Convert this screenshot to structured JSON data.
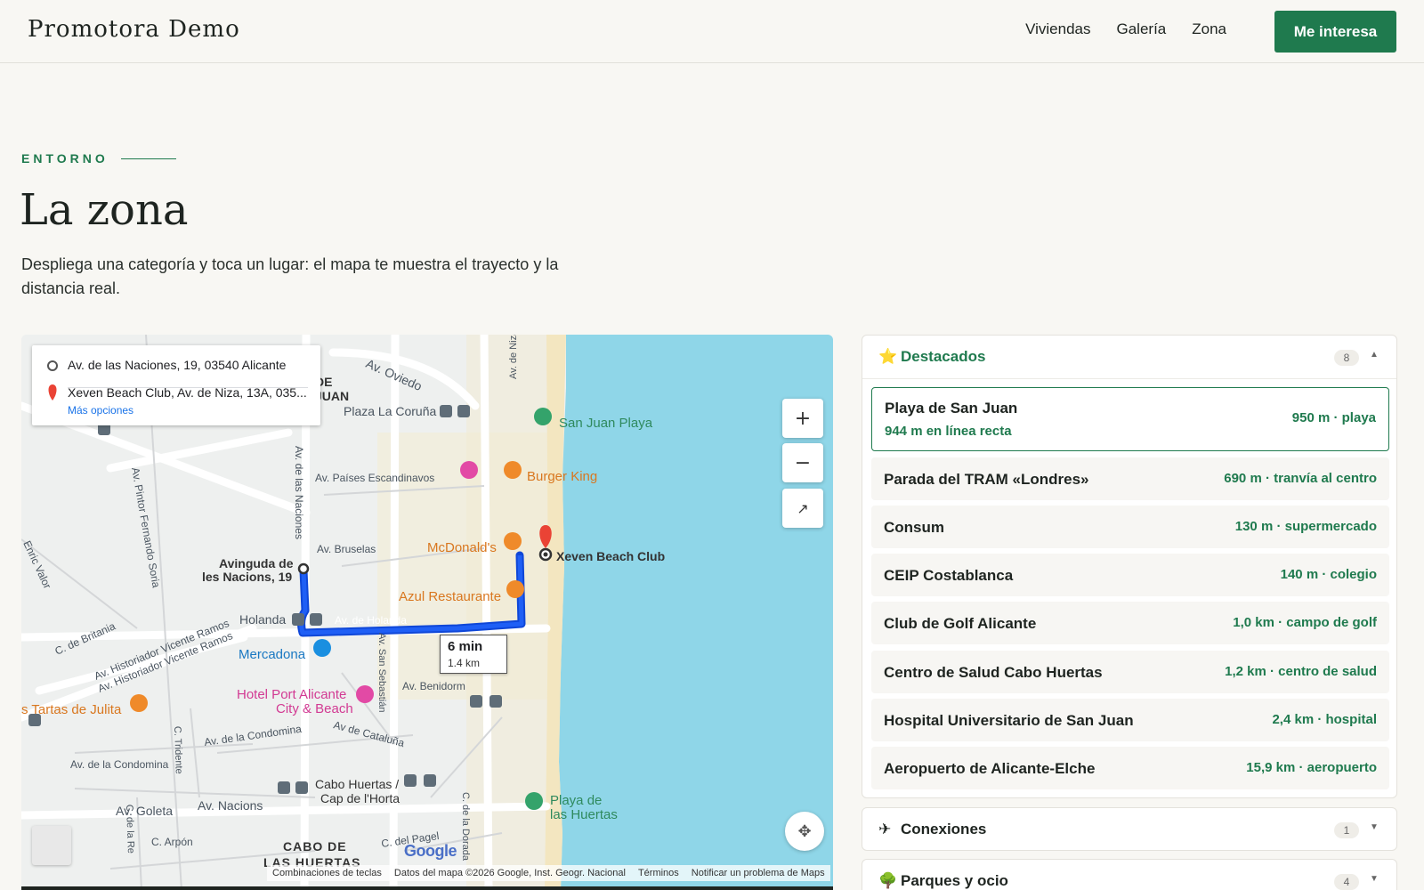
{
  "header": {
    "brand": "Promotora Demo",
    "nav": [
      "Viviendas",
      "Galería",
      "Zona"
    ],
    "cta": "Me interesa"
  },
  "section": {
    "eyebrow": "ENTORNO",
    "title": "La zona",
    "lead": "Despliega una categoría y toca un lugar: el mapa te muestra el trayecto y la distancia real."
  },
  "map": {
    "origin": "Av. de las Naciones, 19, 03540 Alicante",
    "destination": "Xeven Beach Club, Av. de Niza, 13A, 035...",
    "more_options": "Más opciones",
    "zoom_in": "+",
    "zoom_out": "−",
    "fullscreen": "↗",
    "route_duration": "6 min",
    "route_distance": "1.4 km",
    "google": "Google",
    "attribution": {
      "shortcuts": "Combinaciones de teclas",
      "data": "Datos del mapa ©2026 Google, Inst. Geogr. Nacional",
      "terms": "Términos",
      "report": "Notificar un problema de Maps"
    },
    "labels": {
      "origin_pin": [
        "Avinguda de",
        "les Nacions, 19"
      ],
      "dest_pin": "Xeven Beach Club",
      "san_juan_playa": "San Juan Playa",
      "burger_king": "Burger King",
      "mcdonalds": "McDonald's",
      "azul": "Azul Restaurante",
      "mercadona": "Mercadona",
      "hotel": [
        "Hotel Port Alicante",
        "City & Beach"
      ],
      "tartas": "s Tartas de Julita",
      "plaza": "Plaza La Coruña",
      "av_oviedo": "Av. Oviedo",
      "av_paises": "Av. Países Escandinavos",
      "av_bruselas": "Av. Bruselas",
      "av_holanda": "Av. de Holanda",
      "holanda": "Holanda",
      "av_naciones": "Av. de las Naciones",
      "av_niza": "Av. de Niza",
      "av_pintor": "Av. Pintor Fernando Soria",
      "enric": "Enric Valor",
      "britania": "C. de Britania",
      "hist1": "Av. Historiador Vicente Ramos",
      "hist2": "Av. Historiador Vicente Ramos",
      "san_sebastian": "Av. San Sebastián",
      "benidorm": "Av. Benidorm",
      "cataluna": "Av de Cataluña",
      "condomina1": "Av. de la Condomina",
      "condomina2": "Av. de la Condomina",
      "tridente": "C. Tridente",
      "cabo_huertas": [
        "Cabo Huertas /",
        "Cap de l'Horta"
      ],
      "goleta": "Av. Goleta",
      "av_nacions": "Av. Nacions",
      "playa_huertas": [
        "Playa de",
        "las Huertas"
      ],
      "cabo_area": [
        "CABO DE",
        "LAS HUERTAS"
      ],
      "arpon": "C. Arpón",
      "pagel": "C. del Pagel",
      "dorada": "C. de la Dorada",
      "de_juan": [
        "DE",
        "JUAN"
      ],
      "c_de_la_re": "C. de la Re"
    }
  },
  "panel": {
    "featured": {
      "icon": "star-icon",
      "title": "Destacados",
      "count": "8",
      "items": [
        {
          "name": "Playa de San Juan",
          "sub": "944 m en línea recta",
          "meta": "950 m · playa"
        },
        {
          "name": "Parada del TRAM «Londres»",
          "meta": "690 m · tranvía al centro"
        },
        {
          "name": "Consum",
          "meta": "130 m · supermercado"
        },
        {
          "name": "CEIP Costablanca",
          "meta": "140 m · colegio"
        },
        {
          "name": "Club de Golf Alicante",
          "meta": "1,0 km · campo de golf"
        },
        {
          "name": "Centro de Salud Cabo Huertas",
          "meta": "1,2 km · centro de salud"
        },
        {
          "name": "Hospital Universitario de San Juan",
          "meta": "2,4 km · hospital"
        },
        {
          "name": "Aeropuerto de Alicante-Elche",
          "meta": "15,9 km · aeropuerto"
        }
      ]
    },
    "connections": {
      "icon": "airplane-icon",
      "title": "Conexiones",
      "count": "1"
    },
    "parks": {
      "icon": "tree-icon",
      "title": "Parques y ocio",
      "count": "4"
    }
  },
  "colors": {
    "accent": "#1f7a4e",
    "sea": "#8fd6e8",
    "route": "#1a53f0"
  }
}
